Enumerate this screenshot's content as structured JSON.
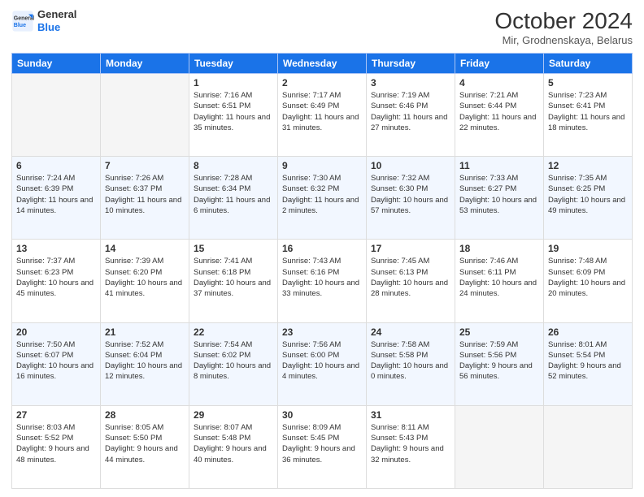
{
  "header": {
    "logo_line1": "General",
    "logo_line2": "Blue",
    "month_title": "October 2024",
    "location": "Mir, Grodnenskaya, Belarus"
  },
  "weekdays": [
    "Sunday",
    "Monday",
    "Tuesday",
    "Wednesday",
    "Thursday",
    "Friday",
    "Saturday"
  ],
  "weeks": [
    [
      {
        "day": "",
        "sunrise": "",
        "sunset": "",
        "daylight": ""
      },
      {
        "day": "",
        "sunrise": "",
        "sunset": "",
        "daylight": ""
      },
      {
        "day": "1",
        "sunrise": "Sunrise: 7:16 AM",
        "sunset": "Sunset: 6:51 PM",
        "daylight": "Daylight: 11 hours and 35 minutes."
      },
      {
        "day": "2",
        "sunrise": "Sunrise: 7:17 AM",
        "sunset": "Sunset: 6:49 PM",
        "daylight": "Daylight: 11 hours and 31 minutes."
      },
      {
        "day": "3",
        "sunrise": "Sunrise: 7:19 AM",
        "sunset": "Sunset: 6:46 PM",
        "daylight": "Daylight: 11 hours and 27 minutes."
      },
      {
        "day": "4",
        "sunrise": "Sunrise: 7:21 AM",
        "sunset": "Sunset: 6:44 PM",
        "daylight": "Daylight: 11 hours and 22 minutes."
      },
      {
        "day": "5",
        "sunrise": "Sunrise: 7:23 AM",
        "sunset": "Sunset: 6:41 PM",
        "daylight": "Daylight: 11 hours and 18 minutes."
      }
    ],
    [
      {
        "day": "6",
        "sunrise": "Sunrise: 7:24 AM",
        "sunset": "Sunset: 6:39 PM",
        "daylight": "Daylight: 11 hours and 14 minutes."
      },
      {
        "day": "7",
        "sunrise": "Sunrise: 7:26 AM",
        "sunset": "Sunset: 6:37 PM",
        "daylight": "Daylight: 11 hours and 10 minutes."
      },
      {
        "day": "8",
        "sunrise": "Sunrise: 7:28 AM",
        "sunset": "Sunset: 6:34 PM",
        "daylight": "Daylight: 11 hours and 6 minutes."
      },
      {
        "day": "9",
        "sunrise": "Sunrise: 7:30 AM",
        "sunset": "Sunset: 6:32 PM",
        "daylight": "Daylight: 11 hours and 2 minutes."
      },
      {
        "day": "10",
        "sunrise": "Sunrise: 7:32 AM",
        "sunset": "Sunset: 6:30 PM",
        "daylight": "Daylight: 10 hours and 57 minutes."
      },
      {
        "day": "11",
        "sunrise": "Sunrise: 7:33 AM",
        "sunset": "Sunset: 6:27 PM",
        "daylight": "Daylight: 10 hours and 53 minutes."
      },
      {
        "day": "12",
        "sunrise": "Sunrise: 7:35 AM",
        "sunset": "Sunset: 6:25 PM",
        "daylight": "Daylight: 10 hours and 49 minutes."
      }
    ],
    [
      {
        "day": "13",
        "sunrise": "Sunrise: 7:37 AM",
        "sunset": "Sunset: 6:23 PM",
        "daylight": "Daylight: 10 hours and 45 minutes."
      },
      {
        "day": "14",
        "sunrise": "Sunrise: 7:39 AM",
        "sunset": "Sunset: 6:20 PM",
        "daylight": "Daylight: 10 hours and 41 minutes."
      },
      {
        "day": "15",
        "sunrise": "Sunrise: 7:41 AM",
        "sunset": "Sunset: 6:18 PM",
        "daylight": "Daylight: 10 hours and 37 minutes."
      },
      {
        "day": "16",
        "sunrise": "Sunrise: 7:43 AM",
        "sunset": "Sunset: 6:16 PM",
        "daylight": "Daylight: 10 hours and 33 minutes."
      },
      {
        "day": "17",
        "sunrise": "Sunrise: 7:45 AM",
        "sunset": "Sunset: 6:13 PM",
        "daylight": "Daylight: 10 hours and 28 minutes."
      },
      {
        "day": "18",
        "sunrise": "Sunrise: 7:46 AM",
        "sunset": "Sunset: 6:11 PM",
        "daylight": "Daylight: 10 hours and 24 minutes."
      },
      {
        "day": "19",
        "sunrise": "Sunrise: 7:48 AM",
        "sunset": "Sunset: 6:09 PM",
        "daylight": "Daylight: 10 hours and 20 minutes."
      }
    ],
    [
      {
        "day": "20",
        "sunrise": "Sunrise: 7:50 AM",
        "sunset": "Sunset: 6:07 PM",
        "daylight": "Daylight: 10 hours and 16 minutes."
      },
      {
        "day": "21",
        "sunrise": "Sunrise: 7:52 AM",
        "sunset": "Sunset: 6:04 PM",
        "daylight": "Daylight: 10 hours and 12 minutes."
      },
      {
        "day": "22",
        "sunrise": "Sunrise: 7:54 AM",
        "sunset": "Sunset: 6:02 PM",
        "daylight": "Daylight: 10 hours and 8 minutes."
      },
      {
        "day": "23",
        "sunrise": "Sunrise: 7:56 AM",
        "sunset": "Sunset: 6:00 PM",
        "daylight": "Daylight: 10 hours and 4 minutes."
      },
      {
        "day": "24",
        "sunrise": "Sunrise: 7:58 AM",
        "sunset": "Sunset: 5:58 PM",
        "daylight": "Daylight: 10 hours and 0 minutes."
      },
      {
        "day": "25",
        "sunrise": "Sunrise: 7:59 AM",
        "sunset": "Sunset: 5:56 PM",
        "daylight": "Daylight: 9 hours and 56 minutes."
      },
      {
        "day": "26",
        "sunrise": "Sunrise: 8:01 AM",
        "sunset": "Sunset: 5:54 PM",
        "daylight": "Daylight: 9 hours and 52 minutes."
      }
    ],
    [
      {
        "day": "27",
        "sunrise": "Sunrise: 8:03 AM",
        "sunset": "Sunset: 5:52 PM",
        "daylight": "Daylight: 9 hours and 48 minutes."
      },
      {
        "day": "28",
        "sunrise": "Sunrise: 8:05 AM",
        "sunset": "Sunset: 5:50 PM",
        "daylight": "Daylight: 9 hours and 44 minutes."
      },
      {
        "day": "29",
        "sunrise": "Sunrise: 8:07 AM",
        "sunset": "Sunset: 5:48 PM",
        "daylight": "Daylight: 9 hours and 40 minutes."
      },
      {
        "day": "30",
        "sunrise": "Sunrise: 8:09 AM",
        "sunset": "Sunset: 5:45 PM",
        "daylight": "Daylight: 9 hours and 36 minutes."
      },
      {
        "day": "31",
        "sunrise": "Sunrise: 8:11 AM",
        "sunset": "Sunset: 5:43 PM",
        "daylight": "Daylight: 9 hours and 32 minutes."
      },
      {
        "day": "",
        "sunrise": "",
        "sunset": "",
        "daylight": ""
      },
      {
        "day": "",
        "sunrise": "",
        "sunset": "",
        "daylight": ""
      }
    ]
  ]
}
